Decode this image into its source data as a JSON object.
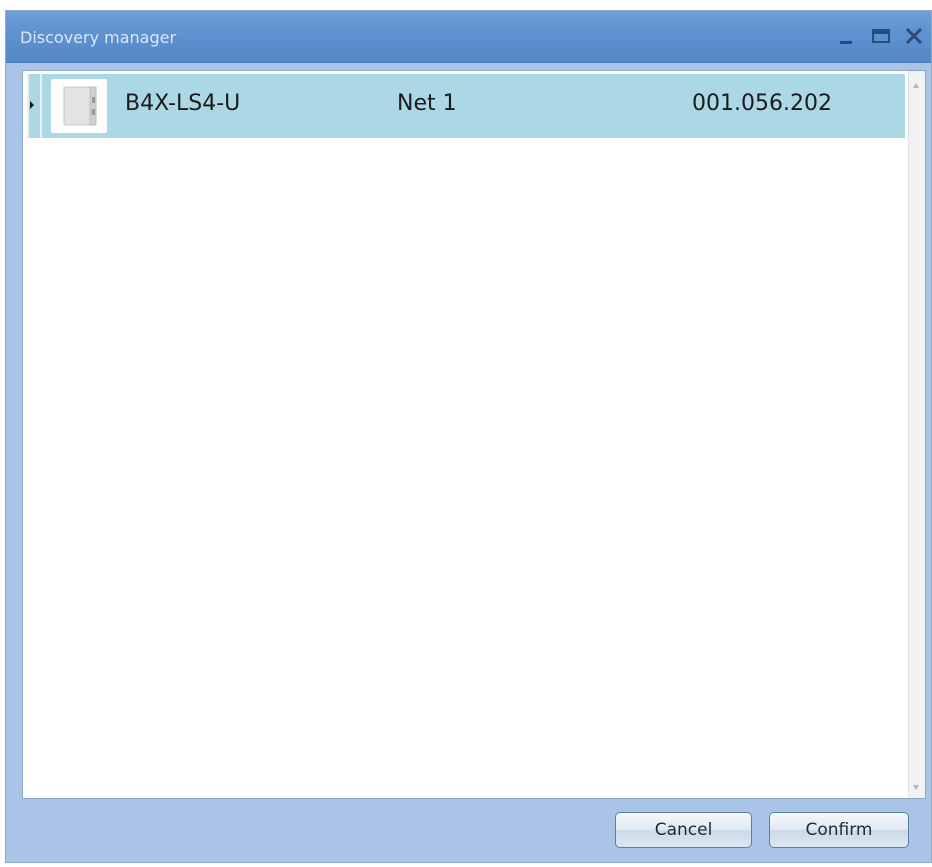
{
  "window": {
    "title": "Discovery manager"
  },
  "devices": [
    {
      "name": "B4X-LS4-U",
      "network": "Net 1",
      "address": "001.056.202",
      "icon": "device-enclosure-icon"
    }
  ],
  "buttons": {
    "cancel": "Cancel",
    "confirm": "Confirm"
  },
  "colors": {
    "titlebar": "#5e91cf",
    "selected_row": "#acd8e6",
    "window_frame": "#a9c4e6"
  }
}
